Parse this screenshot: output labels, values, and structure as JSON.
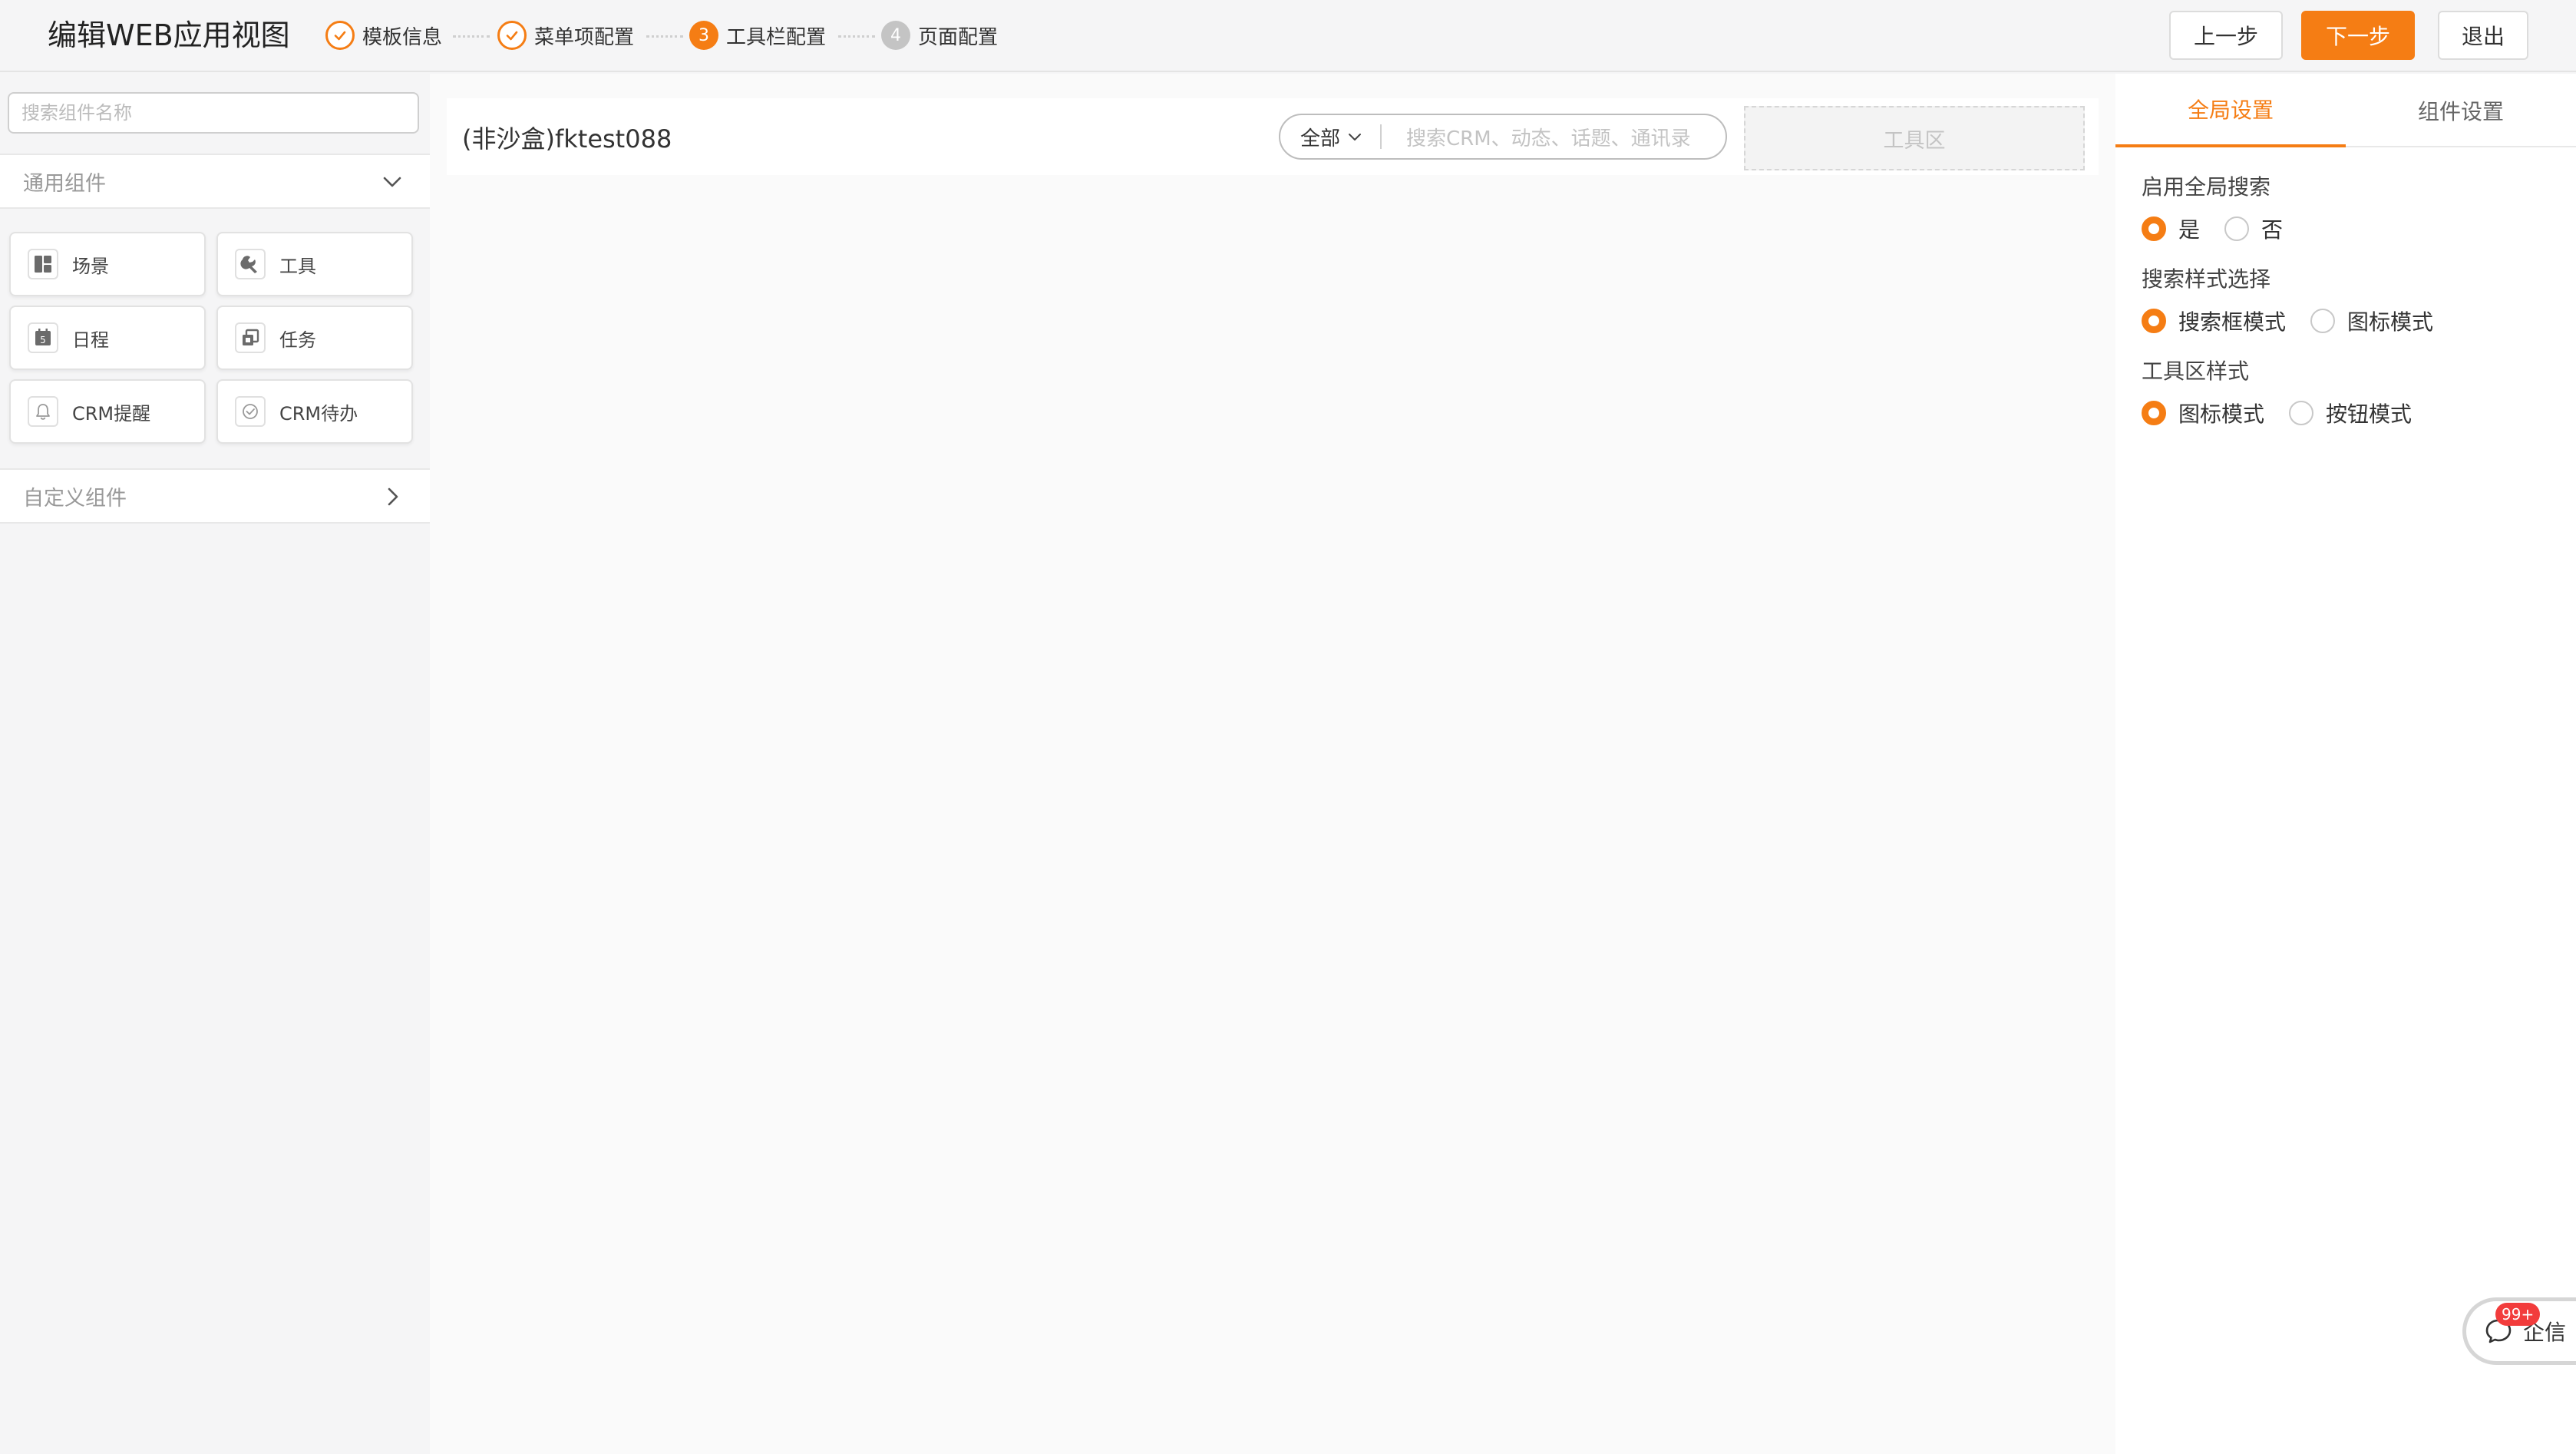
{
  "header": {
    "title": "编辑WEB应用视图",
    "steps": [
      {
        "label": "模板信息",
        "status": "done"
      },
      {
        "label": "菜单项配置",
        "status": "done"
      },
      {
        "label": "工具栏配置",
        "status": "active",
        "number": "3"
      },
      {
        "label": "页面配置",
        "status": "todo",
        "number": "4"
      }
    ],
    "prev_label": "上一步",
    "next_label": "下一步",
    "exit_label": "退出"
  },
  "left_panel": {
    "search_placeholder": "搜索组件名称",
    "common_section": "通用组件",
    "components": [
      {
        "label": "场景",
        "icon": "layout-icon"
      },
      {
        "label": "工具",
        "icon": "wrench-icon"
      },
      {
        "label": "日程",
        "icon": "calendar-icon"
      },
      {
        "label": "任务",
        "icon": "task-icon"
      },
      {
        "label": "CRM提醒",
        "icon": "bell-icon"
      },
      {
        "label": "CRM待办",
        "icon": "check-circle-icon"
      }
    ],
    "custom_section": "自定义组件"
  },
  "canvas": {
    "toolbar_name": "(非沙盒)fktest088",
    "search_scope": "全部",
    "search_placeholder": "搜索CRM、动态、话题、通讯录",
    "tools_area": "工具区"
  },
  "right_panel": {
    "tabs": [
      "全局设置",
      "组件设置"
    ],
    "active_tab": "全局设置",
    "fields": [
      {
        "label": "启用全局搜索",
        "options": [
          "是",
          "否"
        ],
        "selected": "是"
      },
      {
        "label": "搜索样式选择",
        "options": [
          "搜索框模式",
          "图标模式"
        ],
        "selected": "搜索框模式"
      },
      {
        "label": "工具区样式",
        "options": [
          "图标模式",
          "按钮模式"
        ],
        "selected": "图标模式"
      }
    ]
  },
  "chat_widget": {
    "badge": "99+",
    "label": "企信"
  },
  "colors": {
    "accent": "#f57d14",
    "badge": "#f23c3c"
  }
}
